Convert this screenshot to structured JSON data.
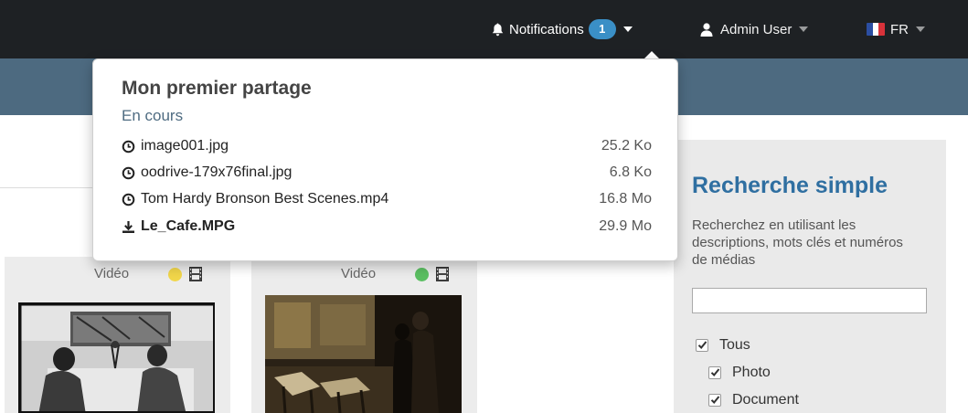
{
  "topbar": {
    "notifications_label": "Notifications",
    "notifications_count": "1",
    "user_label": "Admin User",
    "lang_label": "FR"
  },
  "dropdown": {
    "title": "Mon premier partage",
    "status": "En cours",
    "files": [
      {
        "name": "image001.jpg",
        "size": "25.2 Ko",
        "icon": "clock-icon"
      },
      {
        "name": "oodrive-179x76final.jpg",
        "size": "6.8 Ko",
        "icon": "clock-icon"
      },
      {
        "name": "Tom Hardy Bronson Best Scenes.mp4",
        "size": "16.8 Mo",
        "icon": "clock-icon"
      },
      {
        "name": "Le_Cafe.MPG",
        "size": "29.9 Mo",
        "icon": "upload-icon"
      }
    ]
  },
  "cards": [
    {
      "type_label": "Vidéo",
      "status_color": "#f1d64a"
    },
    {
      "type_label": "Vidéo",
      "status_color": "#5bbf62"
    }
  ],
  "search": {
    "title": "Recherche simple",
    "description": "Recherchez en utilisant les descriptions, mots clés et numéros de médias",
    "input_value": "",
    "filters": [
      {
        "label": "Tous",
        "checked": true
      },
      {
        "label": "Photo",
        "checked": true
      },
      {
        "label": "Document",
        "checked": true
      }
    ]
  },
  "colors": {
    "topbar": "#1e2124",
    "subbar": "#4d6a80",
    "accent": "#2f6fa1",
    "badge": "#3a8fc6"
  }
}
